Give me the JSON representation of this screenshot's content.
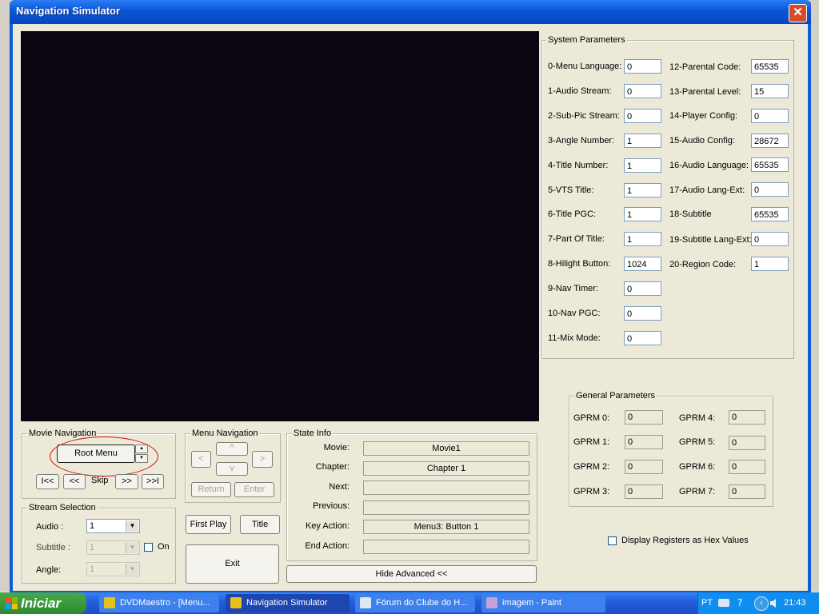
{
  "window": {
    "title": "Navigation Simulator",
    "close": "✕"
  },
  "system_parameters": {
    "title": "System Parameters",
    "left": [
      {
        "label": "0-Menu Language:",
        "value": "0"
      },
      {
        "label": "1-Audio Stream:",
        "value": "0"
      },
      {
        "label": "2-Sub-Pic Stream:",
        "value": "0"
      },
      {
        "label": "3-Angle Number:",
        "value": "1"
      },
      {
        "label": "4-Title Number:",
        "value": "1"
      },
      {
        "label": "5-VTS Title:",
        "value": "1"
      },
      {
        "label": "6-Title PGC:",
        "value": "1"
      },
      {
        "label": "7-Part Of Title:",
        "value": "1"
      },
      {
        "label": "8-Hilight Button:",
        "value": "1024"
      },
      {
        "label": "9-Nav Timer:",
        "value": "0"
      },
      {
        "label": "10-Nav PGC:",
        "value": "0"
      },
      {
        "label": "11-Mix Mode:",
        "value": "0"
      }
    ],
    "right": [
      {
        "label": "12-Parental Code:",
        "value": "65535"
      },
      {
        "label": "13-Parental Level:",
        "value": "15"
      },
      {
        "label": "14-Player Config:",
        "value": "0"
      },
      {
        "label": "15-Audio Config:",
        "value": "28672"
      },
      {
        "label": "16-Audio Language:",
        "value": "65535"
      },
      {
        "label": "17-Audio Lang-Ext:",
        "value": "0"
      },
      {
        "label": "18-Subtitle",
        "value": "65535"
      },
      {
        "label": "19-Subtitle Lang-Ext:",
        "value": "0"
      },
      {
        "label": "20-Region Code:",
        "value": "1"
      }
    ]
  },
  "general_parameters": {
    "title": "General Parameters",
    "left": [
      {
        "label": "GPRM 0:",
        "value": "0"
      },
      {
        "label": "GPRM 1:",
        "value": "0"
      },
      {
        "label": "GPRM 2:",
        "value": "0"
      },
      {
        "label": "GPRM 3:",
        "value": "0"
      }
    ],
    "right": [
      {
        "label": "GPRM 4:",
        "value": "0"
      },
      {
        "label": "GPRM 5:",
        "value": "0"
      },
      {
        "label": "GPRM 6:",
        "value": "0"
      },
      {
        "label": "GPRM 7:",
        "value": "0"
      }
    ],
    "hex_checkbox_label": "Display Registers as Hex Values"
  },
  "movie_navigation": {
    "title": "Movie Navigation",
    "root_menu": "Root Menu",
    "spin_up": "▲",
    "spin_down": "▼",
    "prev_chapter": "I<<",
    "rewind": "<<",
    "skip": "Skip",
    "forward": ">>",
    "next_chapter": ">>I"
  },
  "menu_navigation": {
    "title": "Menu Navigation",
    "up": "^",
    "down": "v",
    "left": "<",
    "right": ">",
    "return": "Return",
    "enter": "Enter"
  },
  "state_info": {
    "title": "State Info",
    "rows": [
      {
        "label": "Movie:",
        "value": "Movie1"
      },
      {
        "label": "Chapter:",
        "value": "Chapter 1"
      },
      {
        "label": "Next:",
        "value": ""
      },
      {
        "label": "Previous:",
        "value": ""
      },
      {
        "label": "Key Action:",
        "value": "Menu3: Button 1"
      },
      {
        "label": "End Action:",
        "value": ""
      }
    ]
  },
  "stream_selection": {
    "title": "Stream Selection",
    "audio_label": "Audio :",
    "audio_value": "1",
    "subtitle_label": "Subtitle :",
    "subtitle_value": "1",
    "subtitle_on_label": "On",
    "angle_label": "Angle:",
    "angle_value": "1"
  },
  "buttons": {
    "first_play": "First Play",
    "title": "Title",
    "exit": "Exit",
    "hide_advanced": "Hide Advanced <<"
  },
  "taskbar": {
    "start": "Iniciar",
    "tasks": [
      "DVDMaestro - [Menu...",
      "Navigation Simulator",
      "Fórum do Clube do H...",
      "imagem - Paint"
    ],
    "language": "PT",
    "clock": "21:43"
  }
}
